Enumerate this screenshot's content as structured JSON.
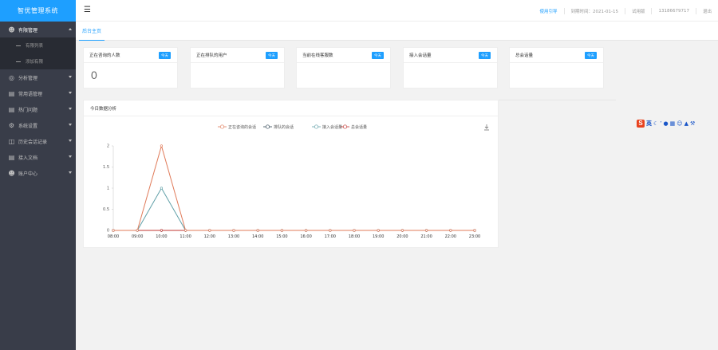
{
  "app": {
    "title": "智优管理系统"
  },
  "sidebar": {
    "items": [
      {
        "label": "有限管理",
        "icon": "user-icon",
        "open": true,
        "children": [
          {
            "label": "有限列表"
          },
          {
            "label": "添加有限"
          }
        ]
      },
      {
        "label": "分析管理",
        "icon": "target-icon"
      },
      {
        "label": "常用语管理",
        "icon": "list-icon"
      },
      {
        "label": "热门问题",
        "icon": "list-icon"
      },
      {
        "label": "系统设置",
        "icon": "gear-icon"
      },
      {
        "label": "历史会话记录",
        "icon": "chat-icon"
      },
      {
        "label": "接入文档",
        "icon": "doc-icon"
      },
      {
        "label": "账户中心",
        "icon": "user-icon"
      }
    ]
  },
  "header": {
    "guide_link": "使用引导",
    "expire": "到期时间：2021-01-15",
    "version": "试用版",
    "phone": "13186679717",
    "logout": "退出"
  },
  "tabs": {
    "active": "后台主页"
  },
  "cards": [
    {
      "title": "正在咨询的人数",
      "badge": "今天",
      "value": "0"
    },
    {
      "title": "正在排队的用户",
      "badge": "今天",
      "value": ""
    },
    {
      "title": "当前在线客服数",
      "badge": "今天",
      "value": ""
    },
    {
      "title": "接入会话量",
      "badge": "今天",
      "value": ""
    },
    {
      "title": "总会话量",
      "badge": "今天",
      "value": ""
    }
  ],
  "panel": {
    "title": "今日数据分析"
  },
  "ime": {
    "label": "英"
  },
  "chart_data": {
    "type": "line",
    "categories": [
      "08:00",
      "09:00",
      "10:00",
      "11:00",
      "12:00",
      "13:00",
      "14:00",
      "15:00",
      "16:00",
      "17:00",
      "18:00",
      "19:00",
      "20:00",
      "21:00",
      "22:00",
      "23:00"
    ],
    "ylim": [
      0,
      2
    ],
    "yticks": [
      "0",
      "0.5",
      "1",
      "1.5",
      "2"
    ],
    "series": [
      {
        "name": "正在咨询的会话",
        "color": "#e07b5a",
        "values": [
          0,
          0,
          2,
          0,
          0,
          0,
          0,
          0,
          0,
          0,
          0,
          0,
          0,
          0,
          0,
          0
        ]
      },
      {
        "name": "排队的会话",
        "color": "#2f4554",
        "values": [
          0,
          0,
          0,
          0,
          0,
          0,
          0,
          0,
          0,
          0,
          0,
          0,
          0,
          0,
          0,
          0
        ]
      },
      {
        "name": "接入会话量",
        "color": "#61a0a8",
        "values": [
          0,
          0,
          1,
          0,
          0,
          0,
          0,
          0,
          0,
          0,
          0,
          0,
          0,
          0,
          0,
          0
        ]
      },
      {
        "name": "总会话量",
        "color": "#c23531",
        "values": [
          0,
          0,
          0,
          0,
          0,
          0,
          0,
          0,
          0,
          0,
          0,
          0,
          0,
          0,
          0,
          0
        ]
      }
    ],
    "legend": "top-center",
    "grid": false
  }
}
